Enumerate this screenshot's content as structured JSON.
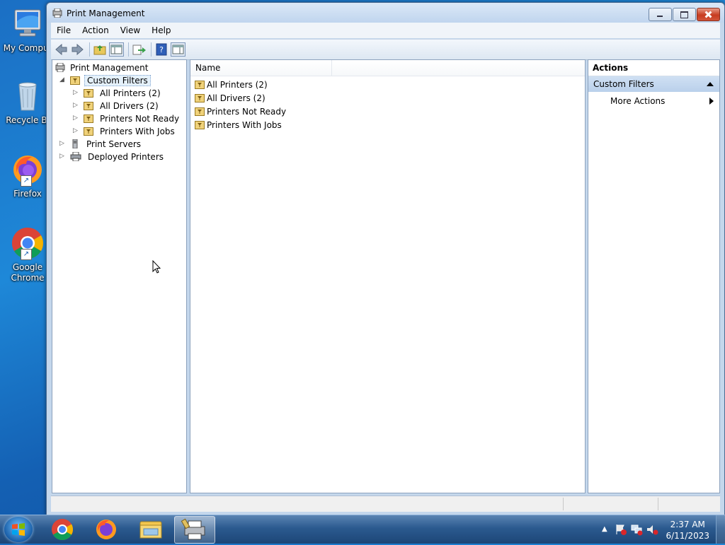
{
  "desktop": {
    "icons": [
      {
        "label": "My Comput",
        "icon": "computer-icon"
      },
      {
        "label": "Recycle Bi",
        "icon": "recycle-bin-icon"
      },
      {
        "label": "Firefox",
        "icon": "firefox-icon"
      },
      {
        "label": "Google Chrome",
        "icon": "chrome-icon"
      }
    ]
  },
  "window": {
    "title": "Print Management",
    "menu": [
      "File",
      "Action",
      "View",
      "Help"
    ],
    "toolbar": [
      "back-icon",
      "forward-icon",
      "up-folder-icon",
      "show-hide-tree-icon",
      "export-list-icon",
      "help-icon",
      "show-hide-action-pane-icon"
    ]
  },
  "tree": {
    "root": "Print Management",
    "custom_filters": "Custom Filters",
    "filters": [
      "All Printers (2)",
      "All Drivers (2)",
      "Printers Not Ready",
      "Printers With Jobs"
    ],
    "print_servers": "Print Servers",
    "deployed_printers": "Deployed Printers"
  },
  "list": {
    "column_name": "Name",
    "rows": [
      "All Printers (2)",
      "All Drivers (2)",
      "Printers Not Ready",
      "Printers With Jobs"
    ]
  },
  "actions": {
    "title": "Actions",
    "group": "Custom Filters",
    "more_actions": "More Actions"
  },
  "taskbar": {
    "time": "2:37 AM",
    "date": "6/11/2023",
    "apps": [
      "chrome-icon",
      "firefox-icon",
      "file-explorer-icon",
      "print-management-icon"
    ]
  },
  "colors": {
    "desktop_bg": "#1e88d8",
    "window_frame": "#c4d7ec",
    "selection": "#e5f1fb",
    "actions_group": "#bad0eb"
  }
}
